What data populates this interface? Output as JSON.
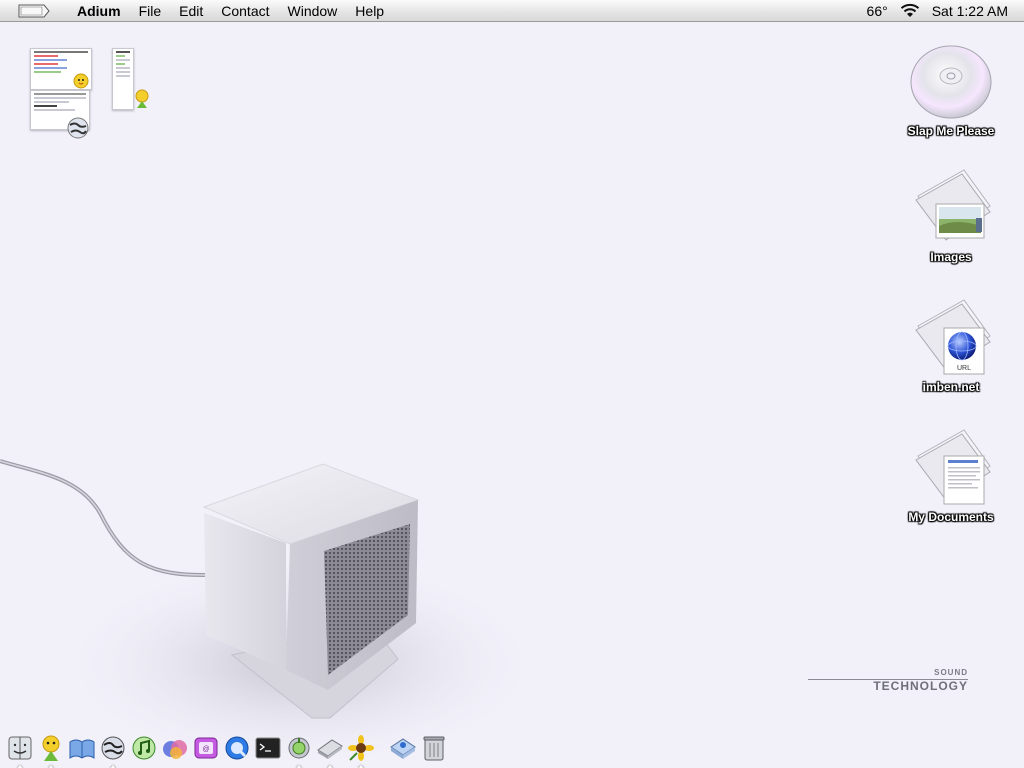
{
  "menubar": {
    "app_name": "Adium",
    "menus": [
      "File",
      "Edit",
      "Contact",
      "Window",
      "Help"
    ],
    "temperature": "66°",
    "clock": "Sat 1:22 AM",
    "icons": {
      "apple": "apple-logo-icon",
      "wifi": "wifi-icon"
    }
  },
  "desktop": {
    "icons": [
      {
        "label": "Slap Me Please",
        "icon": "cd-disc-icon"
      },
      {
        "label": "Images",
        "icon": "image-folder-icon"
      },
      {
        "label": "imben.net",
        "icon": "url-file-icon",
        "badge": "URL"
      },
      {
        "label": "My Documents",
        "icon": "documents-folder-icon"
      }
    ],
    "wallpaper_brand": {
      "small": "SOUND",
      "large": "TECHNOLOGY"
    }
  },
  "dock": {
    "items": [
      {
        "name": "finder",
        "running": true
      },
      {
        "name": "adium",
        "running": true
      },
      {
        "name": "dictionary",
        "running": false
      },
      {
        "name": "internet-connect",
        "running": true
      },
      {
        "name": "itunes",
        "running": false
      },
      {
        "name": "photo-app",
        "running": false
      },
      {
        "name": "ical",
        "running": false
      },
      {
        "name": "quicktime",
        "running": false
      },
      {
        "name": "terminal",
        "running": false
      },
      {
        "name": "disk-utility",
        "running": true
      },
      {
        "name": "hard-drive",
        "running": true
      },
      {
        "name": "sunflower",
        "running": true
      },
      {
        "name": "applications-folder",
        "running": false
      },
      {
        "name": "trash",
        "running": false
      }
    ]
  },
  "colors": {
    "desktop_bg": "#f2f0f9",
    "menubar_bg": "#e4e4e4"
  }
}
